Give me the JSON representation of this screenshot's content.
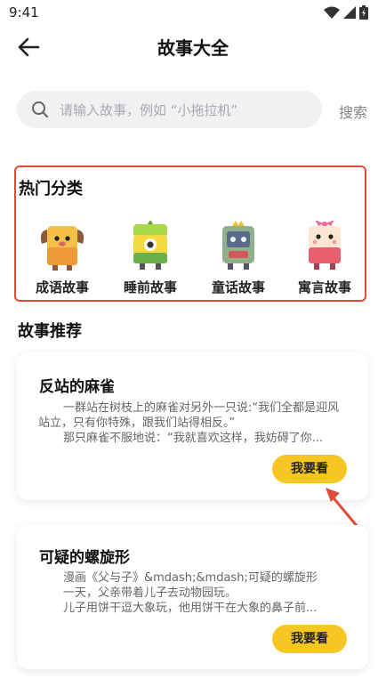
{
  "status_bar": {
    "time": "9:41"
  },
  "header": {
    "title": "故事大全"
  },
  "search": {
    "placeholder": "请输入故事，例如 “小拖拉机”",
    "button_label": "搜索"
  },
  "hot_categories": {
    "title": "热门分类",
    "items": [
      {
        "label": "成语故事",
        "icon": "dog-mascot-icon"
      },
      {
        "label": "睡前故事",
        "icon": "cyclops-mascot-icon"
      },
      {
        "label": "童话故事",
        "icon": "robot-mascot-icon"
      },
      {
        "label": "寓言故事",
        "icon": "bunny-mascot-icon"
      }
    ]
  },
  "recommend": {
    "title": "故事推荐",
    "stories": [
      {
        "title": "反站的麻雀",
        "lines": [
          "一群站在树枝上的麻雀对另外一只说:“我们全都是迎风站立，只有你特殊，跟我们站得相反。”",
          "那只麻雀不服地说：“我就喜欢这样，我妨碍了你..."
        ],
        "button": "我要看"
      },
      {
        "title": "可疑的螺旋形",
        "lines": [
          "漫画《父与子》&mdash;&mdash;可疑的螺旋形",
          "一天，父亲带着儿子去动物园玩。",
          "儿子用饼干逗大象玩，他用饼干在大象的鼻子前..."
        ],
        "button": "我要看"
      }
    ]
  },
  "colors": {
    "accent": "#f6c623",
    "highlight": "#e04a3a"
  }
}
